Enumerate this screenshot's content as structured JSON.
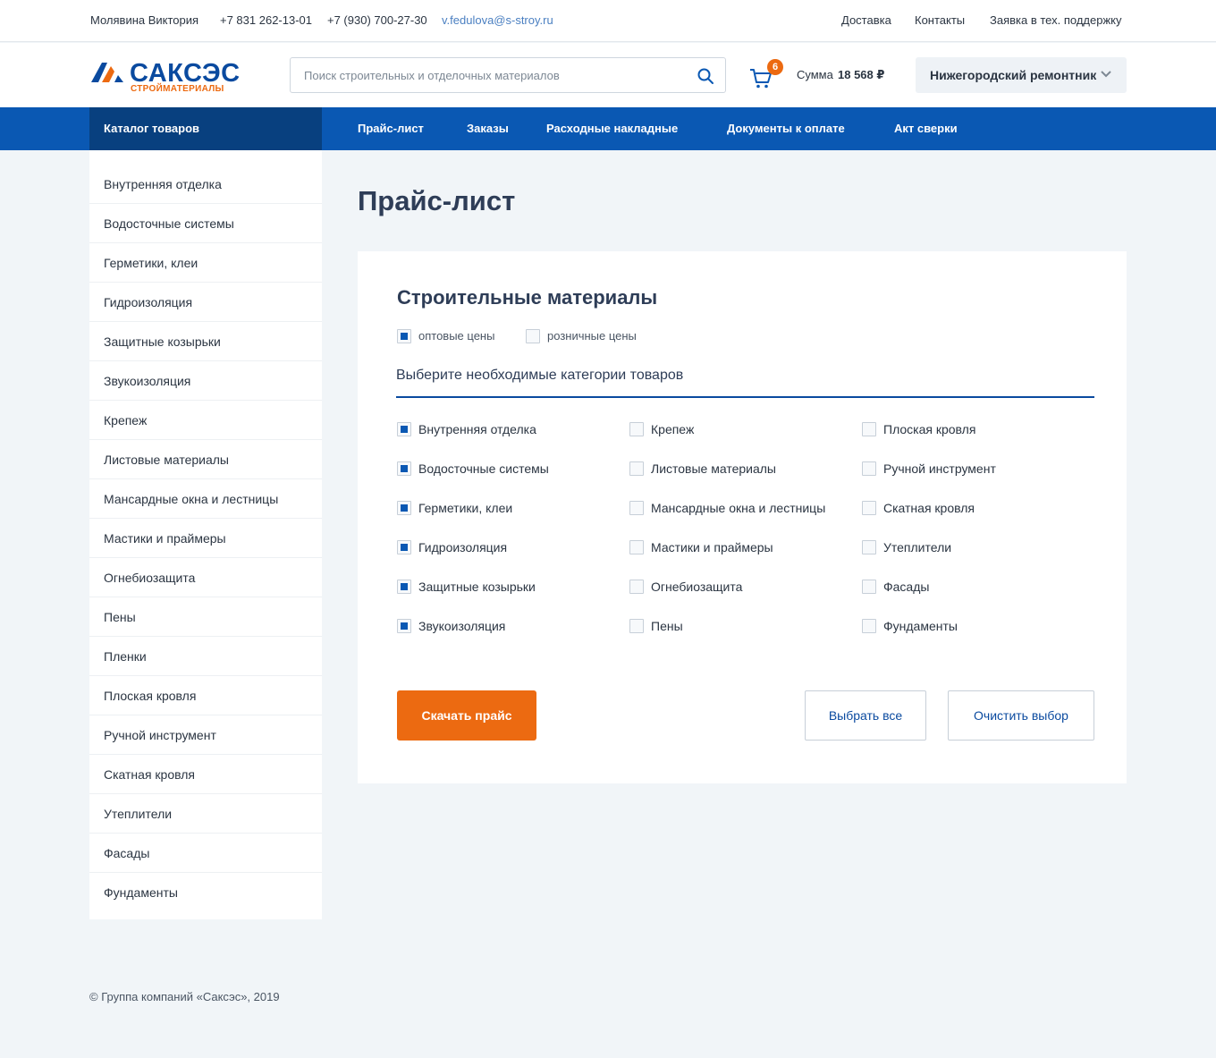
{
  "topbar": {
    "user_name": "Молявина Виктория",
    "phone1": "+7 831 262-13-01",
    "phone2": "+7 (930) 700-27-30",
    "email": "v.fedulova@s-stroy.ru",
    "links": [
      "Доставка",
      "Контакты",
      "Заявка в тех. поддержку"
    ]
  },
  "header": {
    "logo_name": "САКСЭС",
    "logo_sub": "СТРОЙМАТЕРИАЛЫ",
    "search_placeholder": "Поиск строительных и отделочных материалов",
    "cart_count": "6",
    "sum_label": "Сумма",
    "sum_value": "18 568 ₽",
    "company": "Нижегородский ремонтник",
    "brand_color": "#0a58b3",
    "accent_color": "#ec6a11"
  },
  "nav": {
    "catalog": "Каталог товаров",
    "links": [
      "Прайс-лист",
      "Заказы",
      "Расходные накладные",
      "Документы к оплате",
      "Акт сверки"
    ]
  },
  "sidebar": {
    "items": [
      "Внутренняя отделка",
      "Водосточные системы",
      "Герметики, клеи",
      "Гидроизоляция",
      "Защитные козырьки",
      "Звукоизоляция",
      "Крепеж",
      "Листовые материалы",
      "Мансардные окна и лестницы",
      "Мастики и праймеры",
      "Огнебиозащита",
      "Пены",
      "Пленки",
      "Плоская кровля",
      "Ручной инструмент",
      "Скатная кровля",
      "Утеплители",
      "Фасады",
      "Фундаменты"
    ]
  },
  "main": {
    "page_title": "Прайс-лист",
    "card_title": "Строительные материалы",
    "price_types": [
      {
        "label": "оптовые цены",
        "checked": true
      },
      {
        "label": "розничные цены",
        "checked": false
      }
    ],
    "section_title": "Выберите необходимые категории товаров",
    "categories": [
      [
        {
          "label": "Внутренняя отделка",
          "checked": true
        },
        {
          "label": "Водосточные системы",
          "checked": true
        },
        {
          "label": "Герметики, клеи",
          "checked": true
        },
        {
          "label": "Гидроизоляция",
          "checked": true
        },
        {
          "label": "Защитные козырьки",
          "checked": true
        },
        {
          "label": "Звукоизоляция",
          "checked": true
        }
      ],
      [
        {
          "label": "Крепеж",
          "checked": false
        },
        {
          "label": "Листовые материалы",
          "checked": false
        },
        {
          "label": "Мансардные окна и лестницы",
          "checked": false
        },
        {
          "label": "Мастики и праймеры",
          "checked": false
        },
        {
          "label": "Огнебиозащита",
          "checked": false
        },
        {
          "label": "Пены",
          "checked": false
        }
      ],
      [
        {
          "label": "Плоская кровля",
          "checked": false
        },
        {
          "label": "Ручной инструмент",
          "checked": false
        },
        {
          "label": "Скатная кровля",
          "checked": false
        },
        {
          "label": "Утеплители",
          "checked": false
        },
        {
          "label": "Фасады",
          "checked": false
        },
        {
          "label": "Фундаменты",
          "checked": false
        }
      ]
    ],
    "download_button": "Скачать прайс",
    "select_all_button": "Выбрать все",
    "clear_button": "Очистить выбор"
  },
  "footer": {
    "copyright": "© Группа компаний «Саксэс», 2019"
  }
}
